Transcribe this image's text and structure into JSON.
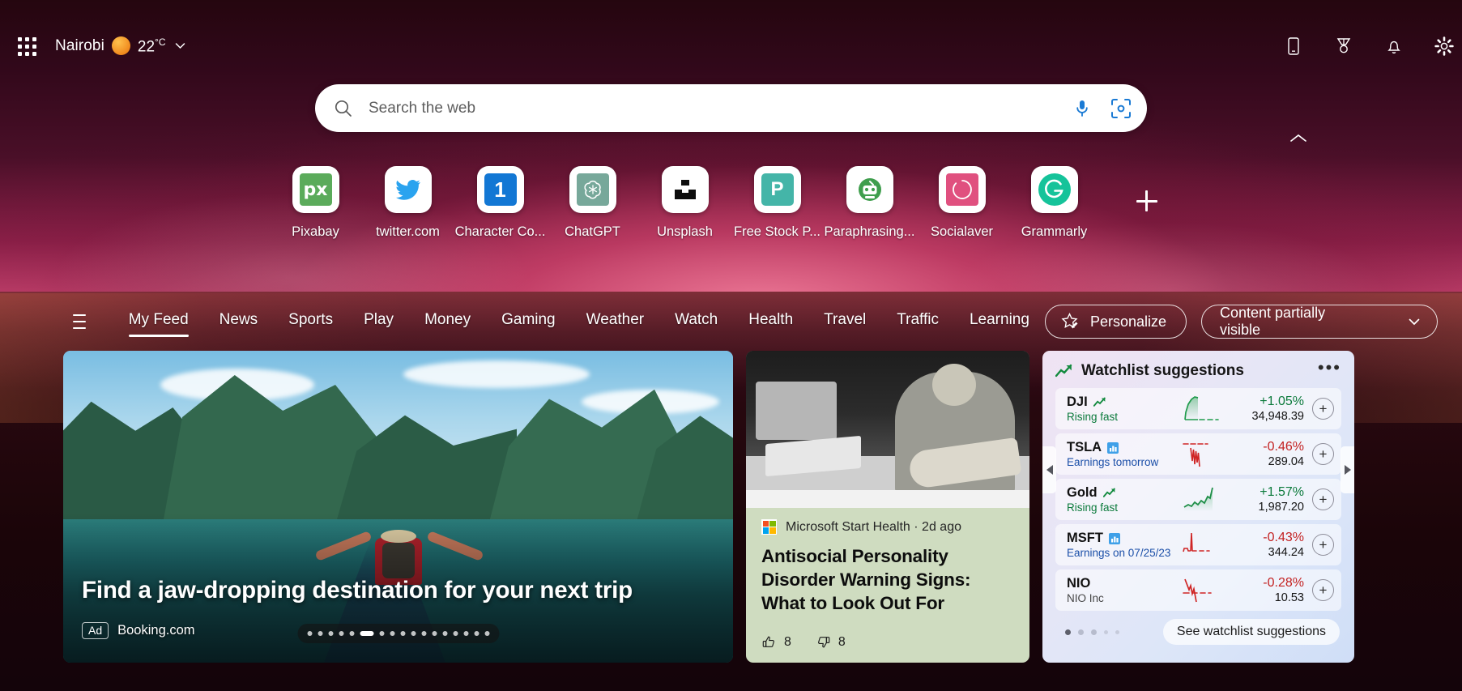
{
  "topbar": {
    "waffle_icon": "app-launcher-icon",
    "city": "Nairobi",
    "temperature": "22",
    "temp_unit": "°C",
    "weather_icon": "sun-icon",
    "chevron_icon": "chevron-down-icon",
    "right_icons": [
      "mobile-phone-icon",
      "rewards-medal-icon",
      "notification-bell-icon",
      "settings-gear-icon"
    ]
  },
  "search": {
    "placeholder": "Search the web",
    "value": "",
    "magnifier_icon": "search-icon",
    "mic_icon": "microphone-icon",
    "lens_icon": "visual-search-icon"
  },
  "shortcuts": {
    "items": [
      {
        "label": "Pixabay",
        "glyph": "px",
        "kind": "px"
      },
      {
        "label": "twitter.com",
        "glyph": "twitter-bird",
        "kind": "twitter"
      },
      {
        "label": "Character Co...",
        "glyph": "1",
        "kind": "one"
      },
      {
        "label": "ChatGPT",
        "glyph": "openai-knot",
        "kind": "gpt"
      },
      {
        "label": "Unsplash",
        "glyph": "unsplash-mark",
        "kind": "unsplash"
      },
      {
        "label": "Free Stock P...",
        "glyph": "P",
        "kind": "pexels"
      },
      {
        "label": "Paraphrasing...",
        "glyph": "robot-head",
        "kind": "robot"
      },
      {
        "label": "Socialaver",
        "glyph": "pink-circle",
        "kind": "social"
      },
      {
        "label": "Grammarly",
        "glyph": "G",
        "kind": "grammarly"
      }
    ],
    "add_label": "+",
    "add_icon": "add-shortcut-icon",
    "collapse_icon": "chevron-up-icon"
  },
  "feednav": {
    "menu_icon": "hamburger-menu-icon",
    "tabs": [
      {
        "label": "My Feed",
        "active": true
      },
      {
        "label": "News",
        "active": false
      },
      {
        "label": "Sports",
        "active": false
      },
      {
        "label": "Play",
        "active": false
      },
      {
        "label": "Money",
        "active": false
      },
      {
        "label": "Gaming",
        "active": false
      },
      {
        "label": "Weather",
        "active": false
      },
      {
        "label": "Watch",
        "active": false
      },
      {
        "label": "Health",
        "active": false
      },
      {
        "label": "Travel",
        "active": false
      },
      {
        "label": "Traffic",
        "active": false
      },
      {
        "label": "Learning",
        "active": false
      }
    ],
    "personalize_label": "Personalize",
    "personalize_icon": "star-pencil-icon",
    "visibility_label": "Content partially visible",
    "visibility_chevron_icon": "chevron-down-icon"
  },
  "hero": {
    "title": "Find a jaw-dropping destination for your next trip",
    "ad_label": "Ad",
    "advertiser": "Booking.com",
    "carousel_total": 17,
    "carousel_current": 6
  },
  "news": {
    "source": "Microsoft Start Health · 2d ago",
    "source_logo": "microsoft-logo-icon",
    "title": "Antisocial Personality Disorder Warning Signs: What to Look Out For",
    "like_icon": "thumbs-up-icon",
    "like_count": "8",
    "dislike_icon": "thumbs-down-icon",
    "dislike_count": "8"
  },
  "watchlist": {
    "title": "Watchlist suggestions",
    "header_icon": "trending-up-icon",
    "more_icon": "more-options-icon",
    "prev_icon": "carousel-prev-icon",
    "next_icon": "carousel-next-icon",
    "see_more_label": "See watchlist suggestions",
    "colors": {
      "up": "#0b7a3b",
      "down": "#c32121"
    },
    "pager": {
      "count": 5,
      "current": 1
    },
    "rows": [
      {
        "symbol": "DJI",
        "badge": "trending-up-icon",
        "subtitle": "Rising fast",
        "subtitle_tone": "green",
        "change": "+1.05%",
        "direction": "up",
        "price": "34,948.39",
        "add_icon": "add-to-watchlist-icon"
      },
      {
        "symbol": "TSLA",
        "badge": "earnings-chart-icon",
        "subtitle": "Earnings tomorrow",
        "subtitle_tone": "blue",
        "change": "-0.46%",
        "direction": "down",
        "price": "289.04",
        "add_icon": "add-to-watchlist-icon"
      },
      {
        "symbol": "Gold",
        "badge": "trending-up-icon",
        "subtitle": "Rising fast",
        "subtitle_tone": "green",
        "change": "+1.57%",
        "direction": "up",
        "price": "1,987.20",
        "add_icon": "add-to-watchlist-icon"
      },
      {
        "symbol": "MSFT",
        "badge": "earnings-chart-icon",
        "subtitle": "Earnings on 07/25/23",
        "subtitle_tone": "blue",
        "change": "-0.43%",
        "direction": "down",
        "price": "344.24",
        "add_icon": "add-to-watchlist-icon"
      },
      {
        "symbol": "NIO",
        "badge": "",
        "subtitle": "NIO Inc",
        "subtitle_tone": "grey",
        "change": "-0.28%",
        "direction": "down",
        "price": "10.53",
        "add_icon": "add-to-watchlist-icon"
      }
    ]
  },
  "chart_data": {
    "type": "line",
    "title": "Watchlist suggestions sparklines",
    "series": [
      {
        "name": "DJI",
        "values": [
          0.05,
          0.08,
          0.3,
          0.62,
          0.9,
          1.0
        ],
        "change_pct": 1.05,
        "last_price": 34948.39,
        "direction": "up"
      },
      {
        "name": "TSLA",
        "values": [
          0.6,
          0.25,
          0.85,
          0.1,
          0.7,
          0.2,
          0.55,
          0.0
        ],
        "change_pct": -0.46,
        "last_price": 289.04,
        "direction": "down"
      },
      {
        "name": "Gold",
        "values": [
          0.12,
          0.2,
          0.15,
          0.3,
          0.26,
          0.4,
          0.35,
          0.55,
          0.7,
          1.0
        ],
        "change_pct": 1.57,
        "last_price": 1987.2,
        "direction": "up"
      },
      {
        "name": "MSFT",
        "values": [
          0.15,
          0.12,
          0.16,
          1.0,
          0.35,
          0.3
        ],
        "change_pct": -0.43,
        "last_price": 344.24,
        "direction": "down"
      },
      {
        "name": "NIO",
        "values": [
          1.0,
          0.55,
          0.7,
          0.3,
          0.45,
          0.0
        ],
        "change_pct": -0.28,
        "last_price": 10.53,
        "direction": "down"
      }
    ],
    "grid": false,
    "legend": "none"
  }
}
